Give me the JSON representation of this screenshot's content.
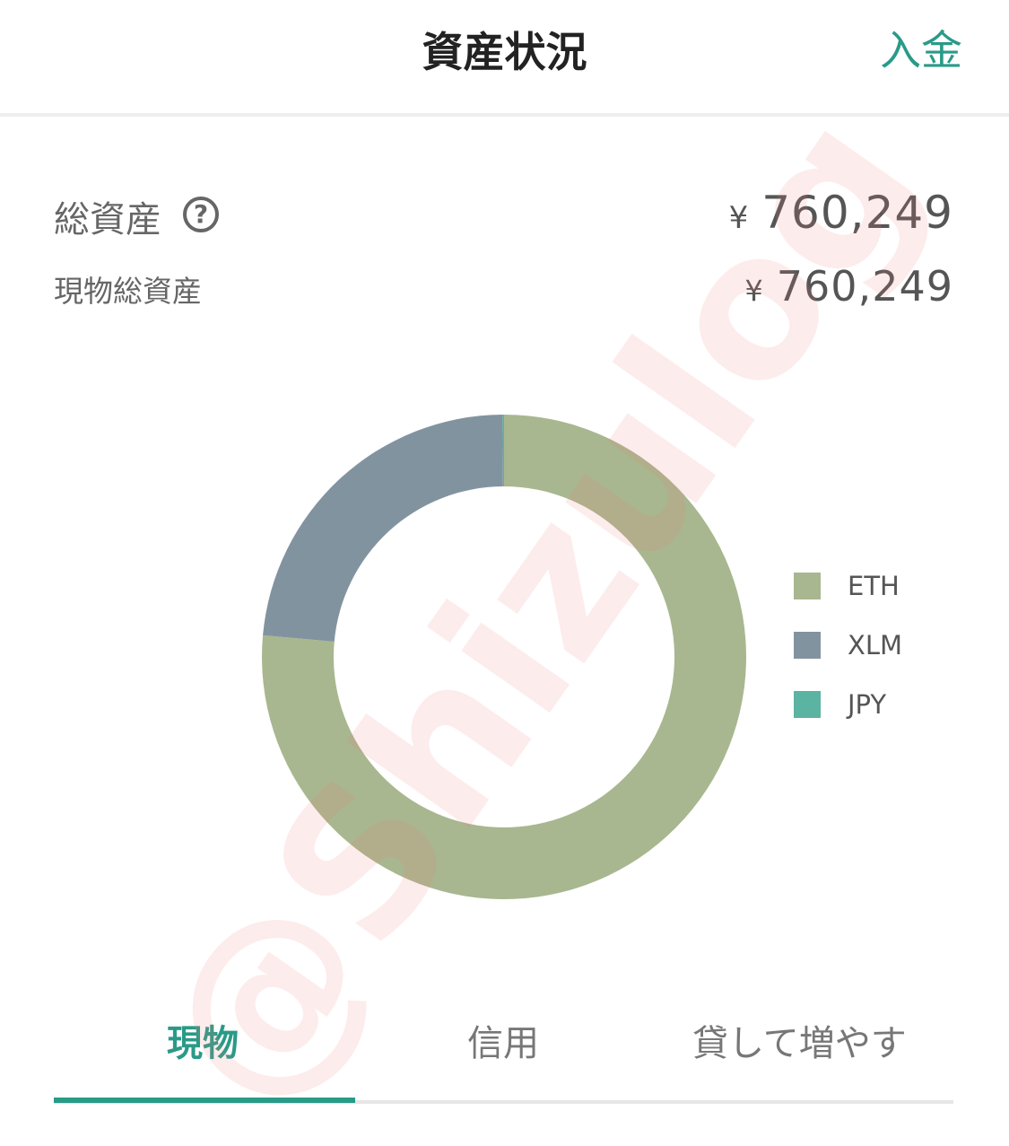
{
  "header": {
    "title": "資産状況",
    "deposit_label": "入金"
  },
  "summary": {
    "total_label": "総資産",
    "help_symbol": "?",
    "total_currency": "¥",
    "total_value": "760,249",
    "spot_label": "現物総資産",
    "spot_currency": "¥",
    "spot_value": "760,249"
  },
  "chart_data": {
    "type": "pie",
    "labels": [
      "ETH",
      "XLM",
      "JPY"
    ],
    "values": [
      76.5,
      23.5,
      0.1
    ],
    "unit": "%",
    "colors": [
      "#a8b78f",
      "#8293a0",
      "#5bb3a2"
    ],
    "donut": true,
    "legend_position": "right"
  },
  "tabs": {
    "spot": "現物",
    "margin": "信用",
    "lend": "貸して増やす",
    "active": "spot"
  },
  "watermark": "@Shizulog",
  "colors": {
    "accent": "#2a9a88",
    "title": "#222222",
    "text": "#555555"
  }
}
